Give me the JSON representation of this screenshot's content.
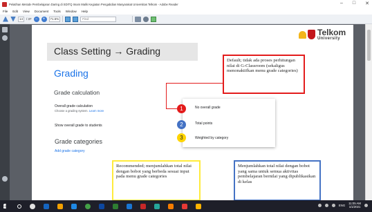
{
  "window": {
    "title": "Pelatihan Metode Pembelajaran Daring  di SDITQ Imam Malik Kegiatan Pengabdian Masyarakat Universitas Telkom - Adobe Reader",
    "controls": [
      "–",
      "□",
      "✕"
    ]
  },
  "menubar": [
    "File",
    "Edit",
    "View",
    "Document",
    "Tools",
    "Window",
    "Help"
  ],
  "toolbar": {
    "page_current": "14",
    "page_total": "/ 37",
    "zoom": "71.6%",
    "find_placeholder": "Find"
  },
  "slide": {
    "title": "Class Setting → Grading",
    "logo": {
      "line1": "Telkom",
      "line2": "University"
    },
    "grading_heading": "Grading",
    "grade_calculation": "Grade calculation",
    "overall_label": "Overall grade calculation",
    "overall_hint": "Choose a grading system.",
    "learn_more": "Learn more",
    "show_overall": "Show overall grade to students",
    "grade_categories": "Grade categories",
    "add_category": "Add grade category",
    "menu_options": [
      {
        "num": "1",
        "label": "No overall grade",
        "color": "#e31b1b"
      },
      {
        "num": "2",
        "label": "Total points",
        "color": "#4472c4"
      },
      {
        "num": "3",
        "label": "Weighted by category",
        "color": "#ffd400"
      }
    ],
    "annotations": {
      "red": "Default; tidak ada proses perhitungan nilai di G-Classroom (sekaligus menonaktifkan menu grade categories)",
      "yellow": "Recommended; menjumlahkan total nilai dengan bobot yang berbeda sesuai input pada menu grade categories",
      "blue": "Menjumlahkan total nilai dengan bobot yang sama untuk semua aktivitas pembelajaran bernilai yang dipublikasikan di kelas"
    }
  },
  "taskbar": {
    "tray_lang": "ENG",
    "time": "11:05 AM",
    "date": "1/1/2021"
  }
}
